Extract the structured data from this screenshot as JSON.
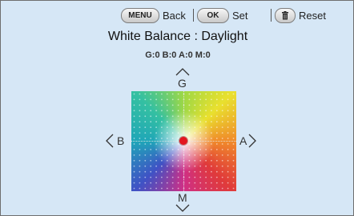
{
  "controls": {
    "menu_key": "MENU",
    "back_label": "Back",
    "ok_key": "OK",
    "set_label": "Set",
    "reset_label": "Reset",
    "reset_icon": "trash-icon"
  },
  "title": "White Balance : Daylight",
  "adjust_values": "G:0 B:0 A:0 M:0",
  "axis": {
    "top": "G",
    "bottom": "M",
    "left": "B",
    "right": "A"
  },
  "icons": [
    "trash-icon",
    "chevron-up-icon",
    "chevron-down-icon",
    "chevron-left-icon",
    "chevron-right-icon"
  ],
  "colors": {
    "background": "#d6e7f6",
    "marker": "#e3161f"
  },
  "selection": {
    "g_m": 0,
    "b_a": 0
  }
}
